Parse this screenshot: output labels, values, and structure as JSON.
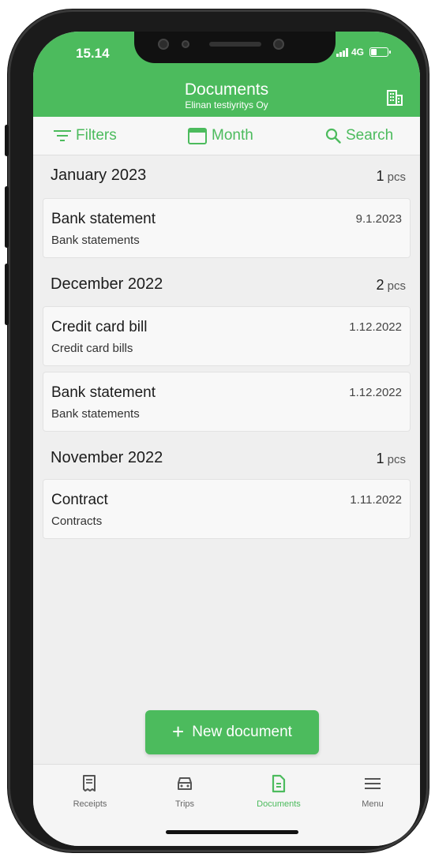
{
  "status_bar": {
    "time": "15.14",
    "network": "4G"
  },
  "header": {
    "title": "Documents",
    "subtitle": "Elinan testiyritys Oy"
  },
  "toolbar": {
    "filters_label": "Filters",
    "month_label": "Month",
    "search_label": "Search"
  },
  "sections": [
    {
      "title": "January 2023",
      "count": "1",
      "count_unit": "pcs",
      "items": [
        {
          "title": "Bank statement",
          "category": "Bank statements",
          "date": "9.1.2023"
        }
      ]
    },
    {
      "title": "December 2022",
      "count": "2",
      "count_unit": "pcs",
      "items": [
        {
          "title": "Credit card bill",
          "category": "Credit card bills",
          "date": "1.12.2022"
        },
        {
          "title": "Bank statement",
          "category": "Bank statements",
          "date": "1.12.2022"
        }
      ]
    },
    {
      "title": "November 2022",
      "count": "1",
      "count_unit": "pcs",
      "items": [
        {
          "title": "Contract",
          "category": "Contracts",
          "date": "1.11.2022"
        }
      ]
    }
  ],
  "fab": {
    "plus": "+",
    "label": "New document"
  },
  "tabs": [
    {
      "label": "Receipts",
      "icon": "receipt-icon"
    },
    {
      "label": "Trips",
      "icon": "car-icon"
    },
    {
      "label": "Documents",
      "icon": "document-icon"
    },
    {
      "label": "Menu",
      "icon": "hamburger-icon"
    }
  ],
  "colors": {
    "accent": "#4cbb5d",
    "background": "#efefef"
  }
}
